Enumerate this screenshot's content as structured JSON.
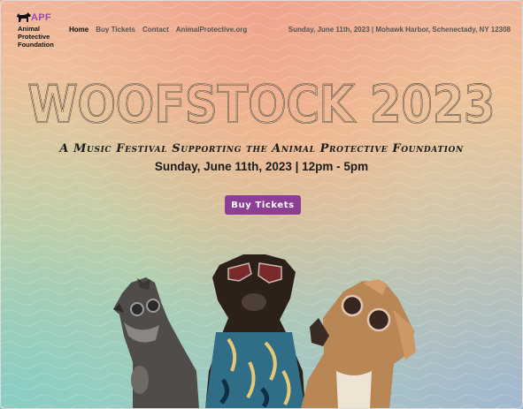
{
  "header": {
    "logo": {
      "abbr": "APF",
      "name": "Animal\nProtective\nFoundation",
      "icon": "dog-silhouette-icon"
    },
    "nav": [
      {
        "label": "Home",
        "active": true
      },
      {
        "label": "Buy Tickets",
        "active": false
      },
      {
        "label": "Contact",
        "active": false
      },
      {
        "label": "AnimalProtective.org",
        "active": false
      }
    ],
    "event_info": "Sunday, June 11th, 2023 | Mohawk Harbor, Schenectady, NY 12308"
  },
  "hero": {
    "title": "WOOFSTOCK 2023",
    "subtitle": "A Music Festival Supporting the Animal Protective Foundation",
    "datetime": "Sunday, June 11th, 2023 | 12pm - 5pm",
    "cta_label": "Buy Tickets"
  },
  "colors": {
    "accent": "#8d3f96",
    "logo": "#9b4aa8",
    "text": "#1c1c1c",
    "nav_text": "#555555"
  },
  "images": [
    "schnauzer-with-sunglasses",
    "dog-with-heart-sunglasses-hawaiian-shirt",
    "tan-dog-with-round-sunglasses"
  ]
}
